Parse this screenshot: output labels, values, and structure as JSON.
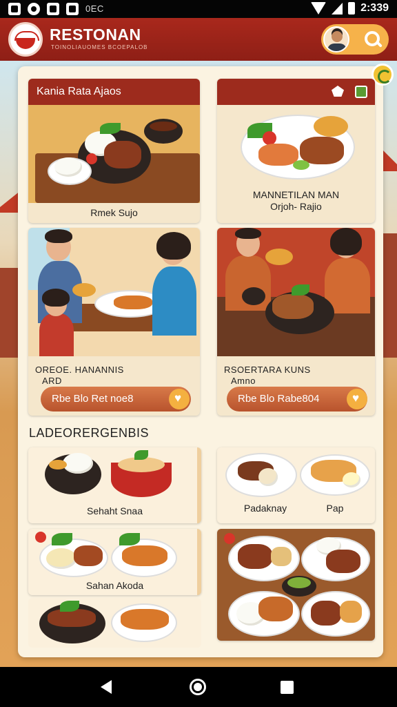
{
  "status_bar": {
    "indicator_text": "0EC",
    "time": "2:339",
    "icons": [
      "image-icon",
      "circle-icon",
      "mail-icon",
      "home-icon",
      "wifi-icon",
      "cell-signal-icon",
      "battery-icon"
    ]
  },
  "app_bar": {
    "title": "RESTONAN",
    "subtitle": "TOINOLIAUOMES BCOEPALOB",
    "actions": [
      "profile-avatar",
      "search-icon"
    ]
  },
  "featured": [
    {
      "header": "Kania Rata Ajaos",
      "caption": "Rmek Sujo"
    },
    {
      "header": "",
      "caption_line1": "MANNETILAN MAN",
      "caption_line2": "Orjoh- Rajio"
    }
  ],
  "order_cards": [
    {
      "title": "OREOE.  HANANNIS",
      "subtitle": "ARD",
      "button": "Rbe Blo Ret noe8"
    },
    {
      "title": "RSOERTARA KUNS",
      "subtitle": "Amno",
      "button": "Rbe Blo Rabe804"
    }
  ],
  "section": {
    "title": "LADEORERGENBIS"
  },
  "dishes": [
    {
      "label": "Sehaht Snaa"
    },
    {
      "label_left": "Padaknay",
      "label_right": "Pap"
    },
    {
      "label": "Sahan Akoda"
    },
    {
      "label": ""
    }
  ],
  "colors": {
    "brand_red": "#9d2b1d",
    "accent_orange": "#f4b040",
    "button_orange": "#c8643a",
    "panel_cream": "#fbf3e1"
  }
}
